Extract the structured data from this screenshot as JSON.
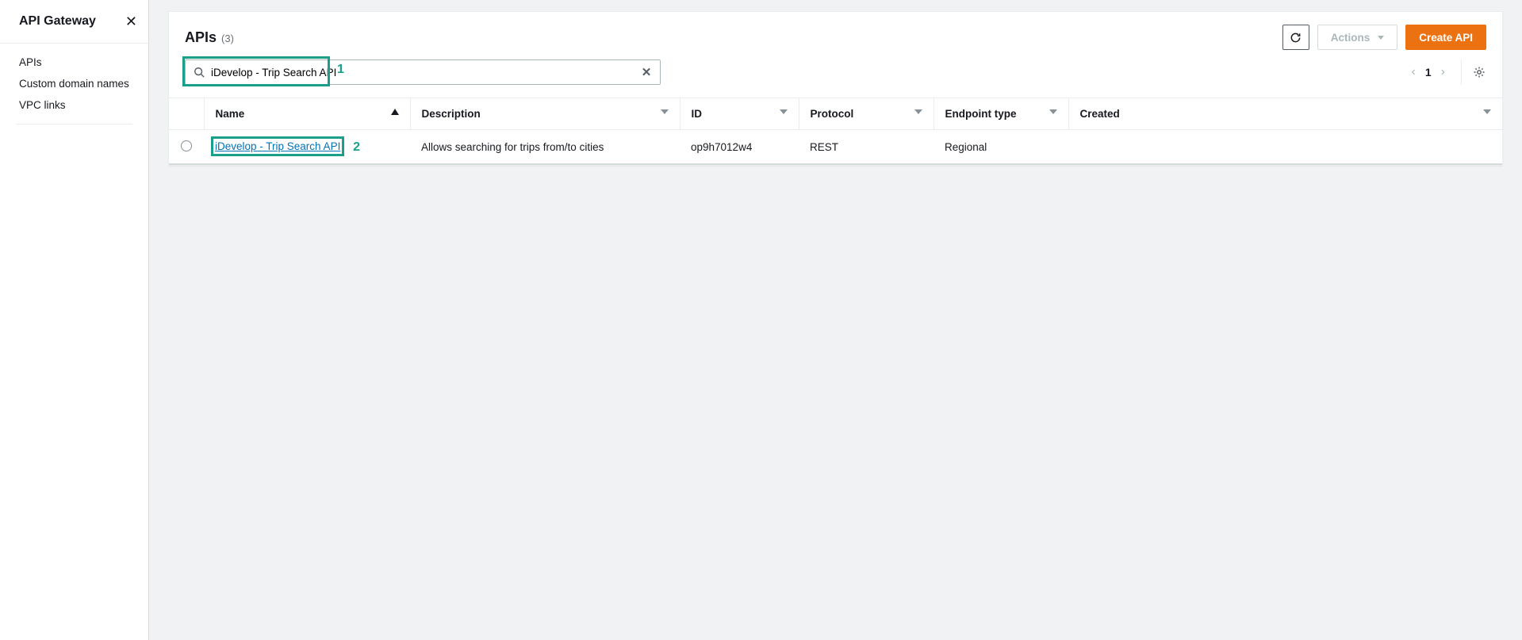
{
  "sidebar": {
    "title": "API Gateway",
    "items": [
      "APIs",
      "Custom domain names",
      "VPC links"
    ]
  },
  "header": {
    "title": "APIs",
    "count": "(3)",
    "refresh_tooltip": "Refresh",
    "actions_label": "Actions",
    "create_label": "Create API"
  },
  "search": {
    "value": "iDevelop - Trip Search API"
  },
  "pagination": {
    "page": "1"
  },
  "annotations": {
    "one": "1",
    "two": "2"
  },
  "table": {
    "columns": {
      "name": "Name",
      "description": "Description",
      "id": "ID",
      "protocol": "Protocol",
      "endpoint": "Endpoint type",
      "created": "Created"
    },
    "rows": [
      {
        "name": "iDevelop - Trip Search API",
        "description": "Allows searching for trips from/to cities",
        "id": "op9h7012w4",
        "protocol": "REST",
        "endpoint": "Regional",
        "created": ""
      }
    ]
  }
}
